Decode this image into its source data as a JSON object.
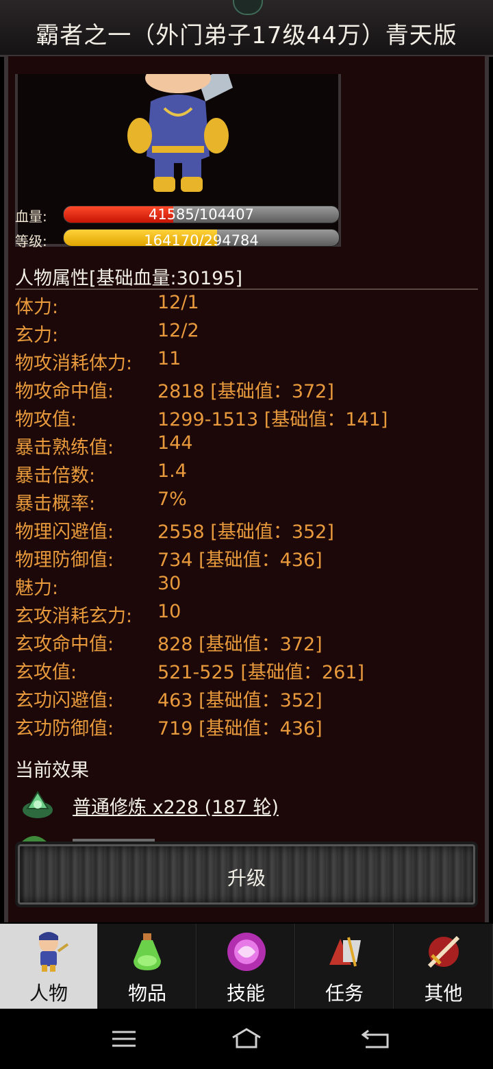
{
  "title": "霸者之一（外门弟子17级44万）青天版",
  "bars": {
    "hp": {
      "label": "血量:",
      "text": "41585/104407",
      "fraction": 0.398
    },
    "exp": {
      "label": "等级:",
      "text": "164170/294784",
      "fraction": 0.557
    }
  },
  "attributes_title": "人物属性[基础血量:30195]",
  "stats": [
    {
      "k": "体力:",
      "v": "12/1"
    },
    {
      "k": "玄力:",
      "v": "12/2"
    },
    {
      "k": "物攻消耗体力:",
      "v": "11"
    },
    {
      "k": "物攻命中值:",
      "v": "2818 [基础值：372]"
    },
    {
      "k": "物攻值:",
      "v": "1299-1513 [基础值：141]"
    },
    {
      "k": "暴击熟练值:",
      "v": "144"
    },
    {
      "k": "暴击倍数:",
      "v": "1.4"
    },
    {
      "k": "暴击概率:",
      "v": "7%"
    },
    {
      "k": "物理闪避值:",
      "v": "2558 [基础值：352]"
    },
    {
      "k": "物理防御值:",
      "v": "734 [基础值：436]"
    },
    {
      "k": "魅力:",
      "v": "30"
    },
    {
      "k": "玄攻消耗玄力:",
      "v": "10"
    },
    {
      "k": "玄攻命中值:",
      "v": "828 [基础值：372]"
    },
    {
      "k": "玄攻值:",
      "v": "521-525 [基础值：261]"
    },
    {
      "k": "玄功闪避值:",
      "v": "463 [基础值：352]"
    },
    {
      "k": "玄功防御值:",
      "v": "719 [基础值：436]"
    }
  ],
  "effects_title": "当前效果",
  "effects": [
    {
      "name": "普通修炼 x228 (187 轮)",
      "icon": "green-orb-icon"
    }
  ],
  "upgrade_label": "升级",
  "tabs": [
    {
      "label": "人物",
      "icon": "character-icon",
      "active": true
    },
    {
      "label": "物品",
      "icon": "potion-icon"
    },
    {
      "label": "技能",
      "icon": "skill-orb-icon"
    },
    {
      "label": "任务",
      "icon": "quest-icon"
    },
    {
      "label": "其他",
      "icon": "sword-icon"
    }
  ]
}
